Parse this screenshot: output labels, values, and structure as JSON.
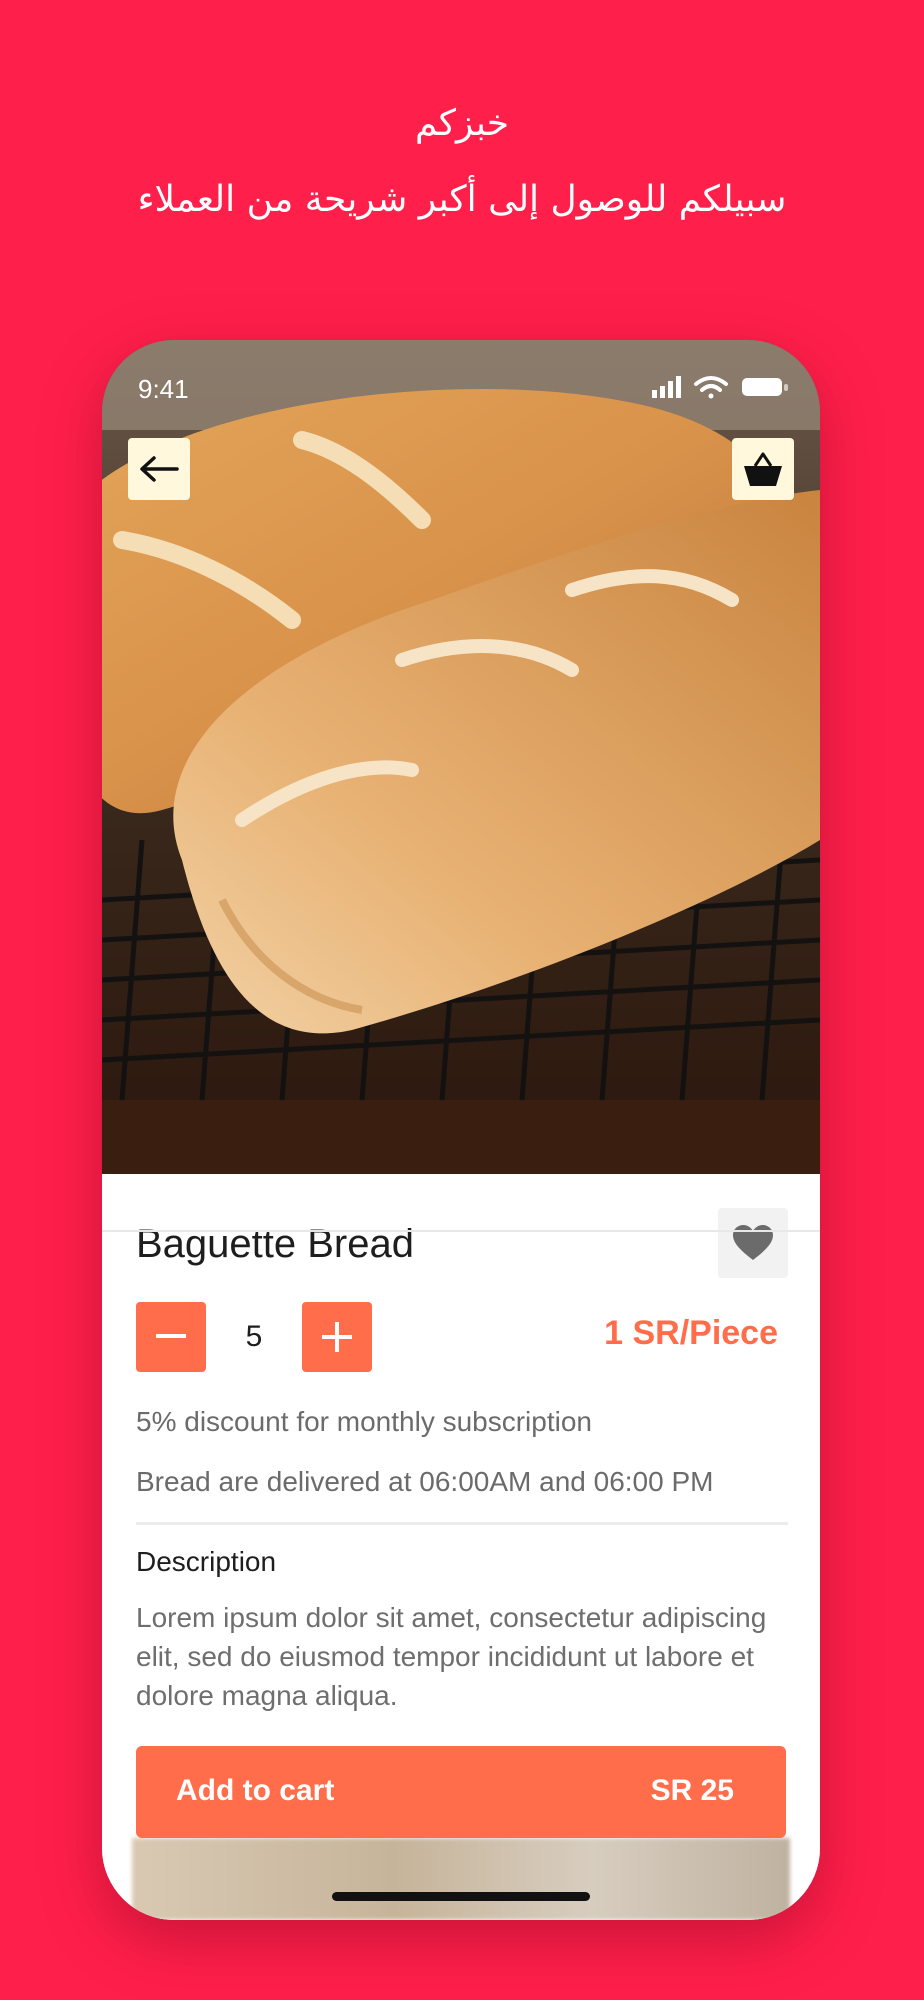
{
  "promo": {
    "line1": "خبزكم",
    "line2": "سبيلكم للوصول إلى أكبر شريحة من العملاء"
  },
  "status_bar": {
    "time": "9:41"
  },
  "icons": {
    "back": "arrow-left-icon",
    "basket": "basket-icon",
    "favorite": "heart-icon",
    "minus": "minus-icon",
    "plus": "plus-icon",
    "signal": "signal-icon",
    "wifi": "wifi-icon",
    "battery": "battery-icon"
  },
  "product": {
    "name": "Baguette Bread",
    "quantity": "5",
    "unit_price": "1 SR/Piece",
    "discount_note": "5% discount for monthly subscription",
    "delivery_note": "Bread are delivered at 06:00AM and 06:00 PM",
    "description_heading": "Description",
    "description": "Lorem ipsum dolor sit amet, consectetur adipiscing elit, sed do eiusmod tempor incididunt ut labore et dolore magna aliqua."
  },
  "cart": {
    "label": "Add to cart",
    "total": "SR 25"
  },
  "colors": {
    "background": "#FF1F4B",
    "accent": "#FF6D4A",
    "icon_button_bg": "#FFF8DC"
  }
}
